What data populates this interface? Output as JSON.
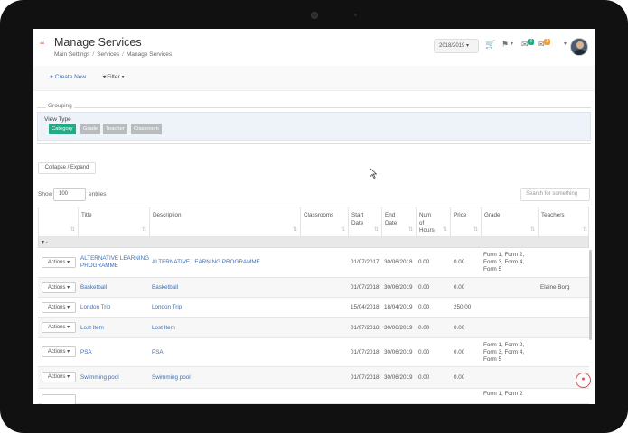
{
  "header": {
    "menu_glyph": "≡",
    "title": "Manage Services",
    "breadcrumb": [
      "Main Settings",
      "Services",
      "Manage Services"
    ],
    "year_select": "2018/2019 ▾",
    "notifications": [
      {
        "icon": "cart-icon",
        "glyph": "🛒",
        "badge": ""
      },
      {
        "icon": "flag-icon",
        "glyph": "⚑",
        "badge": "",
        "caret": "▾"
      },
      {
        "icon": "chat-icon",
        "glyph": "✉",
        "badge": "3"
      },
      {
        "icon": "mail-icon",
        "glyph": "✉",
        "badge": "1"
      }
    ],
    "user_caret": "▾"
  },
  "toolbar": {
    "create_new": "Create New",
    "filter": "Filter ▾"
  },
  "grouping": {
    "label": "Grouping",
    "view_type_label": "View Type",
    "view_types": [
      {
        "label": "Category",
        "active": true
      },
      {
        "label": "Grade",
        "active": false
      },
      {
        "label": "Teacher",
        "active": false
      },
      {
        "label": "Classroom",
        "active": false
      }
    ]
  },
  "collapse_expand": "Collapse / Expand",
  "list_controls": {
    "show": "Show",
    "entries_value": "100",
    "entries": "entries",
    "search_placeholder": "Search for something"
  },
  "table": {
    "columns": [
      "",
      "Title",
      "Description",
      "Classrooms",
      "Start Date",
      "End Date",
      "Num of Hours",
      "Price",
      "Grade",
      "Teachers"
    ],
    "group_toggle": "▾ -",
    "actions_label": "Actions ▾",
    "rows": [
      {
        "title": "ALTERNATIVE LEARNING PROGRAMME",
        "description": "ALTERNATIVE LEARNING PROGRAMME",
        "classrooms": "",
        "start": "01/07/2017",
        "end": "30/06/2018",
        "hours": "0.00",
        "price": "0.00",
        "grade": "Form 1, Form 2, Form 3, Form 4, Form 5",
        "teachers": ""
      },
      {
        "title": "Basketball",
        "description": "Basketball",
        "classrooms": "",
        "start": "01/07/2018",
        "end": "30/06/2019",
        "hours": "0.00",
        "price": "0.00",
        "grade": "",
        "teachers": "Elaine Borg"
      },
      {
        "title": "London Trip",
        "description": "London Trip",
        "classrooms": "",
        "start": "15/04/2018",
        "end": "18/04/2019",
        "hours": "0.00",
        "price": "250.00",
        "grade": "",
        "teachers": ""
      },
      {
        "title": "Lost Item",
        "description": "Lost Item",
        "classrooms": "",
        "start": "01/07/2018",
        "end": "30/06/2019",
        "hours": "0.00",
        "price": "0.00",
        "grade": "",
        "teachers": ""
      },
      {
        "title": "PSA",
        "description": "PSA",
        "classrooms": "",
        "start": "01/07/2018",
        "end": "30/06/2019",
        "hours": "0.00",
        "price": "0.00",
        "grade": "Form 1, Form 2, Form 3, Form 4, Form 5",
        "teachers": ""
      },
      {
        "title": "Swimming pool",
        "description": "Swimming pool",
        "classrooms": "",
        "start": "01/07/2018",
        "end": "30/06/2019",
        "hours": "0.00",
        "price": "0.00",
        "grade": "",
        "teachers": ""
      },
      {
        "title": "",
        "description": "",
        "classrooms": "",
        "start": "",
        "end": "",
        "hours": "",
        "price": "",
        "grade": "Form 1, Form 2",
        "teachers": ""
      }
    ]
  },
  "colors": {
    "accent": "#e0524a",
    "link": "#3c6fb6",
    "active_view": "#26a985",
    "inactive_view": "#b9bcbf"
  }
}
